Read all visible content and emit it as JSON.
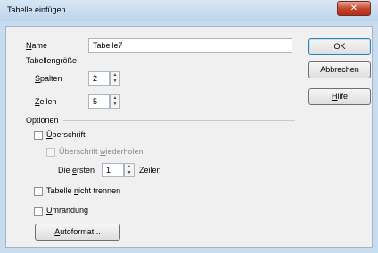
{
  "window": {
    "title": "Tabelle einfügen",
    "close_glyph": "✕"
  },
  "name": {
    "label_u": "N",
    "label_rest": "ame",
    "value": "Tabelle7"
  },
  "size": {
    "section": "Tabellengröße",
    "columns_label_u": "S",
    "columns_label_rest": "palten",
    "columns_value": "2",
    "rows_label_u": "Z",
    "rows_label_rest": "eilen",
    "rows_value": "5"
  },
  "options": {
    "section": "Optionen",
    "heading_u": "Ü",
    "heading_rest": "berschrift",
    "repeat_a": "Überschrift ",
    "repeat_u": "w",
    "repeat_b": "iederholen",
    "first_a": "Die ",
    "first_u": "e",
    "first_b": "rsten",
    "first_value": "1",
    "first_suffix": "Zeilen",
    "nosplit_a": "Tabelle ",
    "nosplit_u": "n",
    "nosplit_b": "icht trennen",
    "border_u": "U",
    "border_rest": "mrandung",
    "autoformat_u": "A",
    "autoformat_rest": "utoformat..."
  },
  "buttons": {
    "ok": "OK",
    "cancel": "Abbrechen",
    "help_u": "H",
    "help_rest": "ilfe"
  }
}
